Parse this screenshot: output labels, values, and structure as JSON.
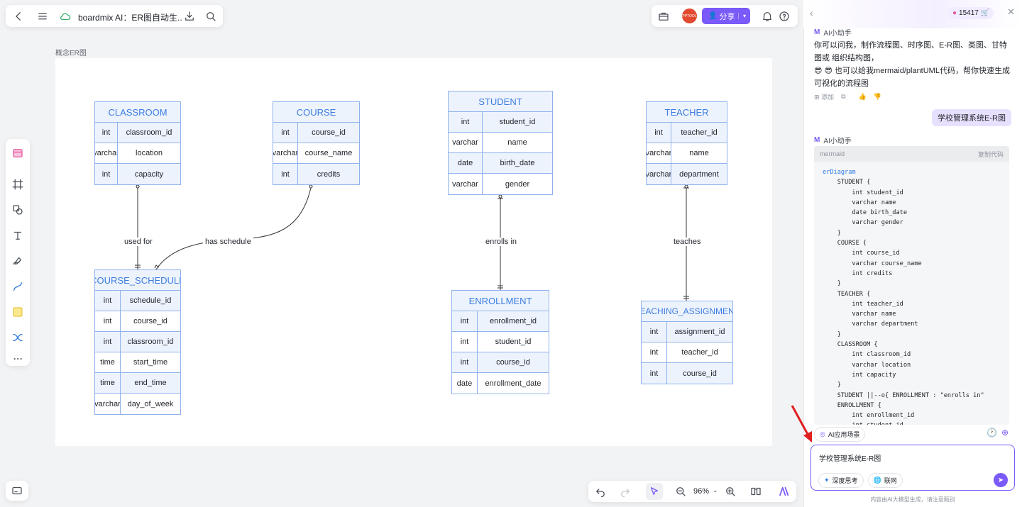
{
  "topbar": {
    "doc_title": "boardmix AI：ER图自动生..",
    "share_label": "分享",
    "avatar_text": "PPTOOL"
  },
  "frame": {
    "label": "概念ER图"
  },
  "entities": {
    "classroom": {
      "title": "CLASSROOM",
      "rows": [
        [
          "int",
          "classroom_id"
        ],
        [
          "varchar",
          "location"
        ],
        [
          "int",
          "capacity"
        ]
      ]
    },
    "course": {
      "title": "COURSE",
      "rows": [
        [
          "int",
          "course_id"
        ],
        [
          "varchar",
          "course_name"
        ],
        [
          "int",
          "credits"
        ]
      ]
    },
    "student": {
      "title": "STUDENT",
      "rows": [
        [
          "int",
          "student_id"
        ],
        [
          "varchar",
          "name"
        ],
        [
          "date",
          "birth_date"
        ],
        [
          "varchar",
          "gender"
        ]
      ]
    },
    "teacher": {
      "title": "TEACHER",
      "rows": [
        [
          "int",
          "teacher_id"
        ],
        [
          "varchar",
          "name"
        ],
        [
          "varchar",
          "department"
        ]
      ]
    },
    "course_schedule": {
      "title": "COURSE_SCHEDULE",
      "rows": [
        [
          "int",
          "schedule_id"
        ],
        [
          "int",
          "course_id"
        ],
        [
          "int",
          "classroom_id"
        ],
        [
          "time",
          "start_time"
        ],
        [
          "time",
          "end_time"
        ],
        [
          "varchar",
          "day_of_week"
        ]
      ]
    },
    "enrollment": {
      "title": "ENROLLMENT",
      "rows": [
        [
          "int",
          "enrollment_id"
        ],
        [
          "int",
          "student_id"
        ],
        [
          "int",
          "course_id"
        ],
        [
          "date",
          "enrollment_date"
        ]
      ]
    },
    "teaching_assignment": {
      "title": "TEACHING_ASSIGNMENT",
      "rows": [
        [
          "int",
          "assignment_id"
        ],
        [
          "int",
          "teacher_id"
        ],
        [
          "int",
          "course_id"
        ]
      ]
    }
  },
  "relations": {
    "used_for": "used for",
    "has_schedule": "has schedule",
    "enrolls_in": "enrolls in",
    "teaches": "teaches"
  },
  "bottombar": {
    "zoom": "96%"
  },
  "panel": {
    "credits": "15417",
    "assistant_name": "AI小助手",
    "intro_1": "你可以问我，制作流程图、时序图、E-R图、类图、甘特图或 组织结构图，",
    "intro_2": "😎 😎 也可以给我mermaid/plantUML代码，帮你快速生成可视化的流程图",
    "add_label": "添加",
    "user_message": "学校管理系统E-R图",
    "code_lang": "mermaid",
    "copy_code": "复制代码",
    "code_lines": [
      "erDiagram",
      "    STUDENT {",
      "        int student_id",
      "        varchar name",
      "        date birth_date",
      "        varchar gender",
      "    }",
      "    COURSE {",
      "        int course_id",
      "        varchar course_name",
      "        int credits",
      "    }",
      "    TEACHER {",
      "        int teacher_id",
      "        varchar name",
      "        varchar department",
      "    }",
      "    CLASSROOM {",
      "        int classroom_id",
      "        varchar location",
      "        int capacity",
      "    }",
      "    STUDENT ||--o{ ENROLLMENT : \"enrolls in\"",
      "    ENROLLMENT {",
      "        int enrollment_id",
      "        int student_id"
    ],
    "scenarios_label": "AI应用场景",
    "input_value": "学校管理系统E-R图",
    "deep_think": "深度思考",
    "web": "联网",
    "disclaimer": "内容由AI大模型生成，请注意甄别"
  }
}
